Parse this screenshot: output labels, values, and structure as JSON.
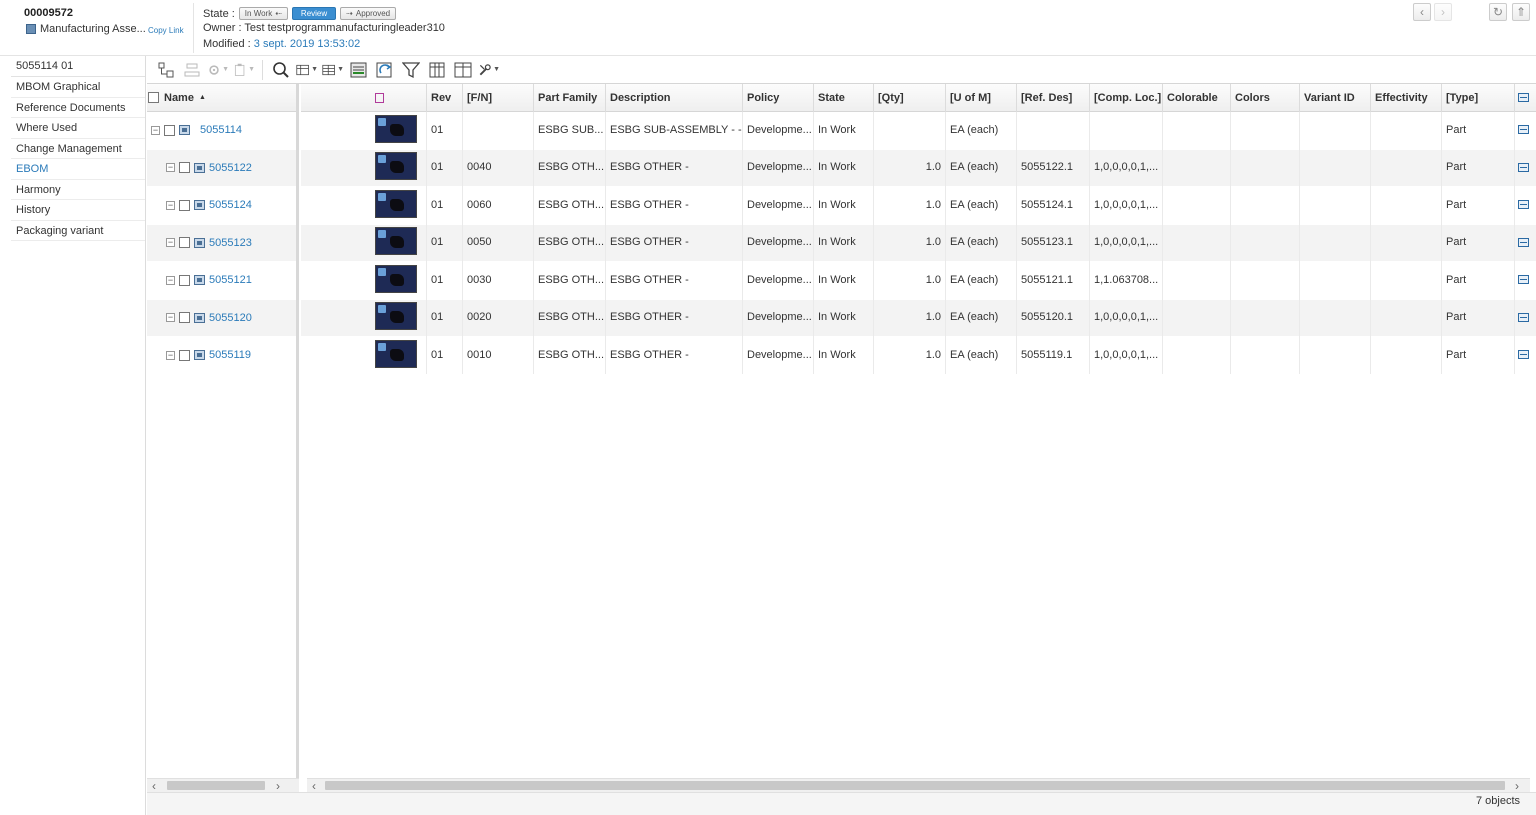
{
  "header": {
    "object_id": "00009572",
    "object_type": "Manufacturing Asse...",
    "copy_link": "Copy Link",
    "state_label": "State :",
    "states": [
      "In Work",
      "Review",
      "Approved"
    ],
    "owner": "Owner : Test testprogrammanufacturingleader310",
    "modified_label": "Modified :",
    "modified_date": "3 sept. 2019 13:53:02"
  },
  "leftnav": {
    "title": "5055114 01",
    "items": [
      {
        "label": "MBOM Graphical"
      },
      {
        "label": "Reference Documents"
      },
      {
        "label": "Where Used"
      },
      {
        "label": "Change Management"
      },
      {
        "label": "EBOM",
        "active": true
      },
      {
        "label": "Harmony"
      },
      {
        "label": "History"
      },
      {
        "label": "Packaging variant"
      }
    ]
  },
  "toolbar": {
    "icons": [
      "expand-structure-icon",
      "collapse-icon",
      "configure-icon",
      "paste-icon",
      "search-icon",
      "table-view-icon",
      "grid-layout-icon",
      "edit-table-icon",
      "refresh-link-icon",
      "filter-icon",
      "fit-columns-icon",
      "columns-icon",
      "tools-icon"
    ]
  },
  "grid": {
    "name_header": "Name",
    "sort_indicator": "▲",
    "columns": [
      "",
      "Rev",
      "[F/N]",
      "Part Family",
      "Description",
      "Policy",
      "State",
      "[Qty]",
      "[U of M]",
      "[Ref. Des]",
      "[Comp. Loc.]",
      "Colorable",
      "Colors",
      "Variant ID",
      "Effectivity",
      "[Type]"
    ],
    "rows": [
      {
        "name": "5055114",
        "level": 0,
        "rev": "01",
        "fn": "",
        "family": "ESBG SUB...",
        "desc": "ESBG SUB-ASSEMBLY - -",
        "policy": "Developme...",
        "state": "In Work",
        "qty": "",
        "uom": "EA (each)",
        "refdes": "",
        "comploc": "",
        "colorable": "",
        "colors": "",
        "variant": "",
        "effectivity": "",
        "type": "Part"
      },
      {
        "name": "5055122",
        "level": 1,
        "rev": "01",
        "fn": "0040",
        "family": "ESBG OTH...",
        "desc": "ESBG OTHER -",
        "policy": "Developme...",
        "state": "In Work",
        "qty": "1.0",
        "uom": "EA (each)",
        "refdes": "5055122.1",
        "comploc": "1,0,0,0,0,1,...",
        "colorable": "",
        "colors": "",
        "variant": "",
        "effectivity": "",
        "type": "Part"
      },
      {
        "name": "5055124",
        "level": 1,
        "rev": "01",
        "fn": "0060",
        "family": "ESBG OTH...",
        "desc": "ESBG OTHER -",
        "policy": "Developme...",
        "state": "In Work",
        "qty": "1.0",
        "uom": "EA (each)",
        "refdes": "5055124.1",
        "comploc": "1,0,0,0,0,1,...",
        "colorable": "",
        "colors": "",
        "variant": "",
        "effectivity": "",
        "type": "Part"
      },
      {
        "name": "5055123",
        "level": 1,
        "rev": "01",
        "fn": "0050",
        "family": "ESBG OTH...",
        "desc": "ESBG OTHER -",
        "policy": "Developme...",
        "state": "In Work",
        "qty": "1.0",
        "uom": "EA (each)",
        "refdes": "5055123.1",
        "comploc": "1,0,0,0,0,1,...",
        "colorable": "",
        "colors": "",
        "variant": "",
        "effectivity": "",
        "type": "Part"
      },
      {
        "name": "5055121",
        "level": 1,
        "rev": "01",
        "fn": "0030",
        "family": "ESBG OTH...",
        "desc": "ESBG OTHER -",
        "policy": "Developme...",
        "state": "In Work",
        "qty": "1.0",
        "uom": "EA (each)",
        "refdes": "5055121.1",
        "comploc": "1,1.063708...",
        "colorable": "",
        "colors": "",
        "variant": "",
        "effectivity": "",
        "type": "Part"
      },
      {
        "name": "5055120",
        "level": 1,
        "rev": "01",
        "fn": "0020",
        "family": "ESBG OTH...",
        "desc": "ESBG OTHER -",
        "policy": "Developme...",
        "state": "In Work",
        "qty": "1.0",
        "uom": "EA (each)",
        "refdes": "5055120.1",
        "comploc": "1,0,0,0,0,1,...",
        "colorable": "",
        "colors": "",
        "variant": "",
        "effectivity": "",
        "type": "Part"
      },
      {
        "name": "5055119",
        "level": 1,
        "rev": "01",
        "fn": "0010",
        "family": "ESBG OTH...",
        "desc": "ESBG OTHER -",
        "policy": "Developme...",
        "state": "In Work",
        "qty": "1.0",
        "uom": "EA (each)",
        "refdes": "5055119.1",
        "comploc": "1,0,0,0,0,1,...",
        "colorable": "",
        "colors": "",
        "variant": "",
        "effectivity": "",
        "type": "Part"
      }
    ]
  },
  "footer": {
    "count": "7 objects"
  },
  "colors": {
    "link": "#2b7bb9",
    "active_state": "#3a8ed1",
    "row_alt": "#f3f3f3"
  }
}
